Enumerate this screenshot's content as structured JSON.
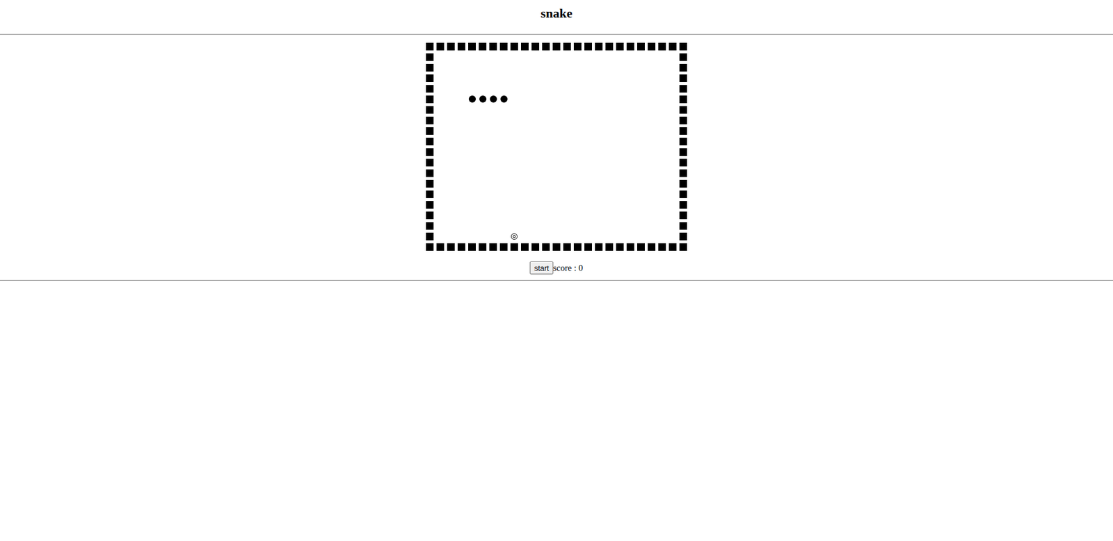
{
  "title": "snake",
  "board": {
    "rows": 20,
    "cols": 25
  },
  "snake": [
    {
      "row": 5,
      "col": 4
    },
    {
      "row": 5,
      "col": 5
    },
    {
      "row": 5,
      "col": 6
    },
    {
      "row": 5,
      "col": 7
    }
  ],
  "food": {
    "row": 18,
    "col": 8
  },
  "controls": {
    "start_button": "start",
    "score": "score : 0"
  }
}
